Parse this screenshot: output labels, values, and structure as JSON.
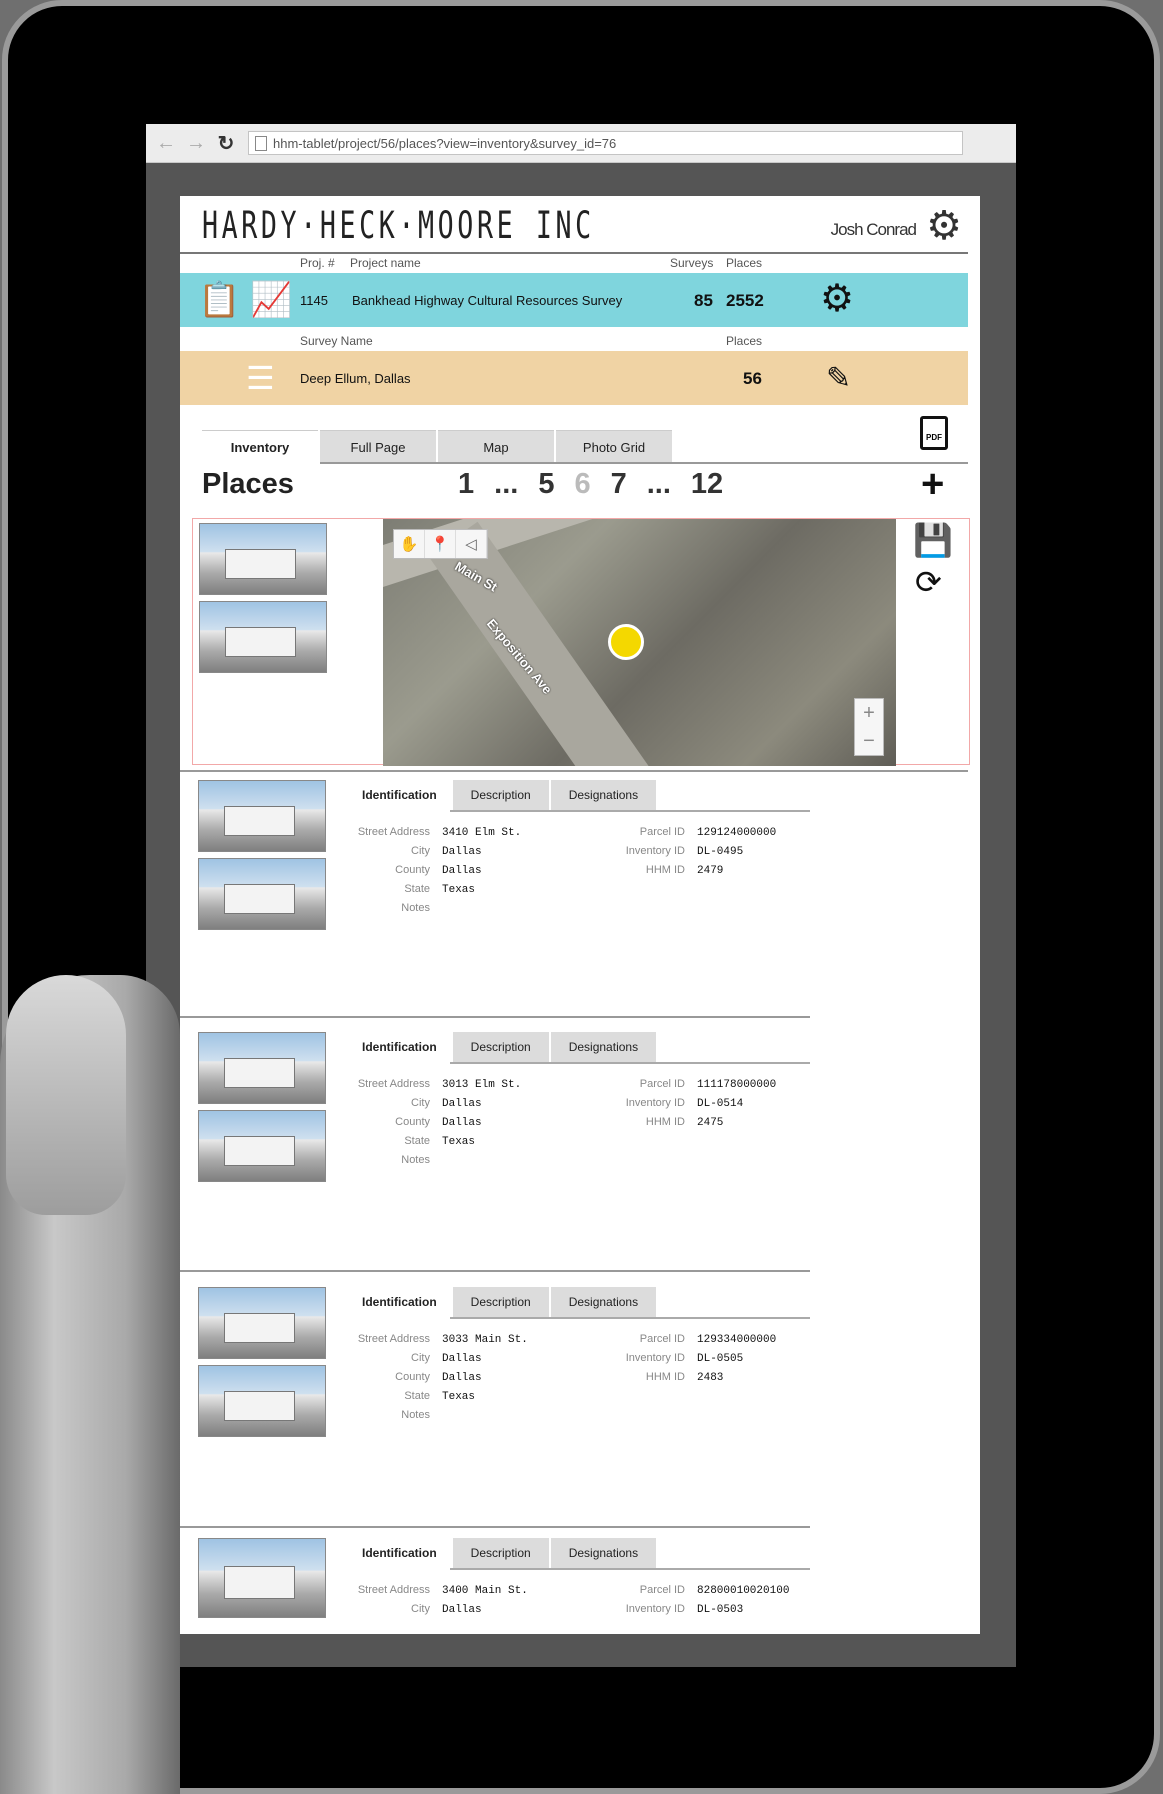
{
  "browser": {
    "url": "hhm-tablet/project/56/places?view=inventory&survey_id=76",
    "back_icon": "back-arrow-icon",
    "forward_icon": "forward-arrow-icon",
    "reload_icon": "reload-icon"
  },
  "header": {
    "logo": "HARDY·HECK·MOORE INC",
    "user_name": "Josh Conrad",
    "settings_icon": "gear-icon"
  },
  "project": {
    "labels": {
      "proj_num": "Proj. #",
      "proj_name": "Project name",
      "surveys": "Surveys",
      "places": "Places"
    },
    "number": "1145",
    "name": "Bankhead Highway Cultural Resources Survey",
    "surveys": "85",
    "places": "2552",
    "accent_color": "#7fd5dd"
  },
  "survey": {
    "labels": {
      "survey_name": "Survey Name",
      "places": "Places"
    },
    "name": "Deep Ellum, Dallas",
    "places": "56",
    "accent_color": "#f0d3a4"
  },
  "tabs": [
    "Inventory",
    "Full Page",
    "Map",
    "Photo Grid"
  ],
  "active_tab": "Inventory",
  "places_title": "Places",
  "pager": [
    "1",
    "...",
    "5",
    "6",
    "7",
    "...",
    "12"
  ],
  "current_page": "6",
  "map": {
    "street_labels": [
      "Main St",
      "Exposition Ave"
    ],
    "tools": [
      "hand-icon",
      "pin-icon",
      "shape-icon"
    ],
    "zoom_in": "+",
    "zoom_out": "−"
  },
  "record_tabs": [
    "Identification",
    "Description",
    "Designations"
  ],
  "field_labels": {
    "street": "Street Address",
    "city": "City",
    "county": "County",
    "state": "State",
    "notes": "Notes",
    "parcel": "Parcel ID",
    "inventory": "Inventory ID",
    "hhm": "HHM ID"
  },
  "records": [
    {
      "street": "3410 Elm St.",
      "city": "Dallas",
      "county": "Dallas",
      "state": "Texas",
      "parcel": "129124000000",
      "inventory": "DL-0495",
      "hhm": "2479"
    },
    {
      "street": "3013 Elm St.",
      "city": "Dallas",
      "county": "Dallas",
      "state": "Texas",
      "parcel": "111178000000",
      "inventory": "DL-0514",
      "hhm": "2475"
    },
    {
      "street": "3033 Main St.",
      "city": "Dallas",
      "county": "Dallas",
      "state": "Texas",
      "parcel": "129334000000",
      "inventory": "DL-0505",
      "hhm": "2483"
    },
    {
      "street": "3400 Main St.",
      "city": "Dallas",
      "county": "",
      "state": "",
      "parcel": "82800010020100",
      "inventory": "DL-0503",
      "hhm": ""
    }
  ]
}
